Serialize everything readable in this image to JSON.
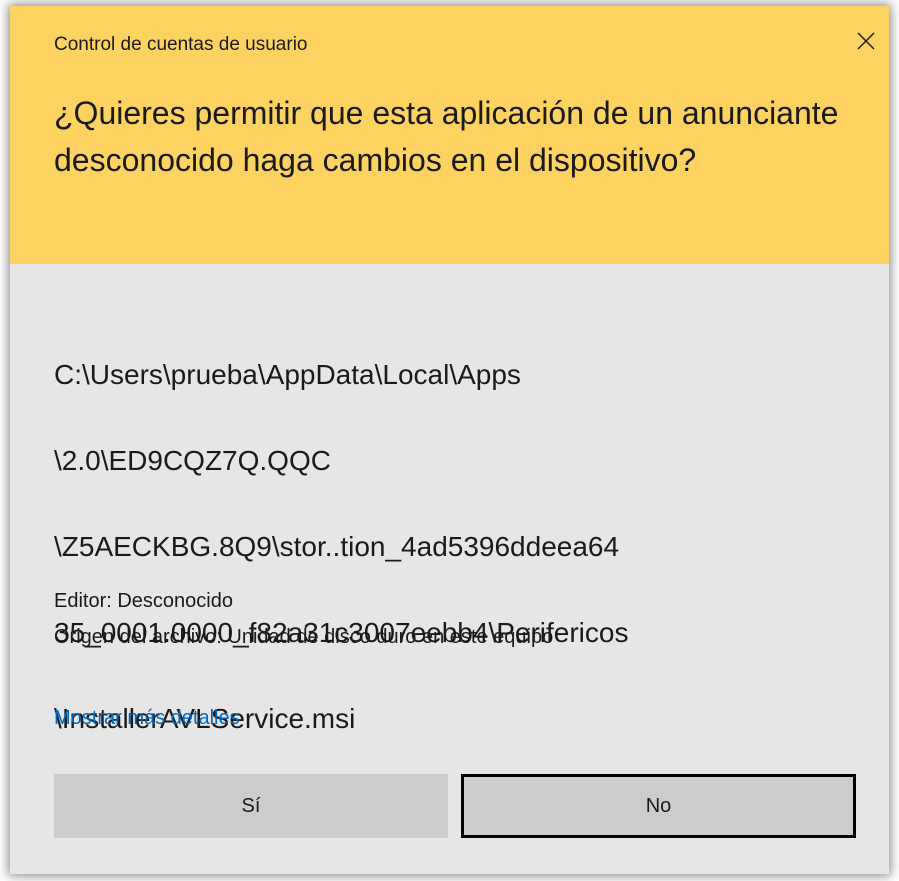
{
  "window": {
    "title": "Control de cuentas de usuario",
    "close_icon": "close-icon"
  },
  "header": {
    "question": "¿Quieres permitir que esta aplicación de un anunciante desconocido haga cambios en el dispositivo?"
  },
  "program": {
    "path_lines": [
      "C:\\Users\\prueba\\AppData\\Local\\Apps",
      "\\2.0\\ED9CQZ7Q.QQC",
      "\\Z5AECKBG.8Q9\\stor..tion_4ad5396ddeea64",
      "35_0001.0000_f82a31c3007eebb4\\Perifericos",
      "\\InstallerAVLService.msi"
    ]
  },
  "info": {
    "publisher": "Editor: Desconocido",
    "origin": "Origen del archivo: Unidad de disco duro en este equipo"
  },
  "details_link": "Mostrar más detalles",
  "buttons": {
    "yes_label": "Sí",
    "no_label": "No"
  },
  "colors": {
    "header_bg": "#fcd260",
    "body_bg": "#e6e6e6",
    "button_bg": "#cccccc",
    "link": "#0067c0",
    "focus_border": "#000000"
  }
}
